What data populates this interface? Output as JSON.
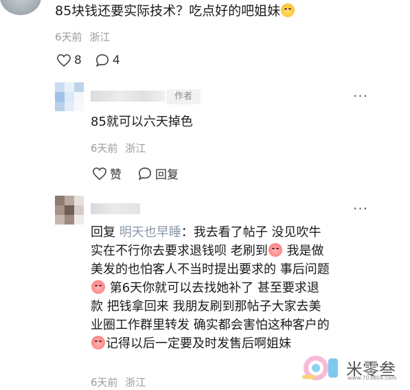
{
  "top_comment": {
    "text": "85块钱还要实际技术？吃点好的吧姐妹",
    "time": "6天前",
    "location": "浙江",
    "likes": "8",
    "replies": "4",
    "emoji": "smile-emoji"
  },
  "reply1": {
    "author_tag": "作者",
    "text": "85就可以六天掉色",
    "time": "6天前",
    "location": "浙江",
    "like_label": "赞",
    "reply_label": "回复",
    "more": "···"
  },
  "reply2": {
    "more": "···",
    "reply_prefix": "回复",
    "mention": "明天也早睡",
    "line1_rest": "：我去看了帖子 没见吹牛",
    "line2": "实在不行你去要求退钱呗 老刷到",
    "line2_tail": " 我是做",
    "line3": "美发的也怕客人不当时提出要求的 事后问题",
    "line4": " 第6天你就可以去找她补了 甚至要求退",
    "line5": "款 把钱拿回来 我朋友刷到那帖子大家去美",
    "line6": "业圈工作群里转发 确实都会害怕这种客户的",
    "line7": "记得以后一定要及时发售后啊姐妹",
    "time": "6天前",
    "location": "浙江",
    "emoji": "crying-emoji"
  },
  "watermark": {
    "name": "米零叁",
    "url": "www.703804.com"
  },
  "colors": {
    "meta_gray": "#9a9a9a",
    "mention_blue_gray": "#8a97a8",
    "author_tag_bg": "#f2f2f2"
  }
}
